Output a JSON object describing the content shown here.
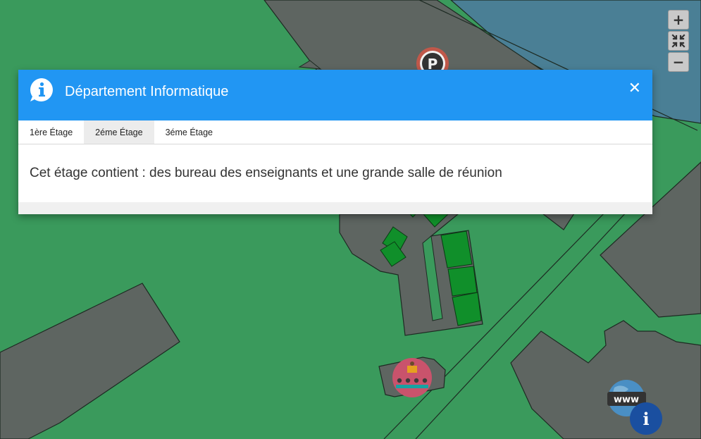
{
  "map": {
    "markers": [
      {
        "name": "parking-marker",
        "icon": "parking-icon",
        "label": "P"
      },
      {
        "name": "classroom-marker",
        "icon": "classroom-icon"
      },
      {
        "name": "website-marker",
        "icon": "globe-www-icon",
        "label": "www"
      },
      {
        "name": "info-marker",
        "icon": "info-icon",
        "label": "i"
      }
    ],
    "colors": {
      "grass": "#3a9a5c",
      "building": "#5e6561",
      "water": "#4a7f95",
      "green_block": "#108f2a"
    }
  },
  "zoom": {
    "in_label": "+",
    "out_label": "−"
  },
  "popup": {
    "title": "Département Informatique",
    "close_label": "✕",
    "tabs": [
      {
        "label": "1ère Étage",
        "active": false
      },
      {
        "label": "2éme Étage",
        "active": true
      },
      {
        "label": "3éme Étage",
        "active": false
      }
    ],
    "content": "Cet étage contient : des bureau des enseignants et une grande salle de réunion",
    "header_color": "#2196f3"
  }
}
